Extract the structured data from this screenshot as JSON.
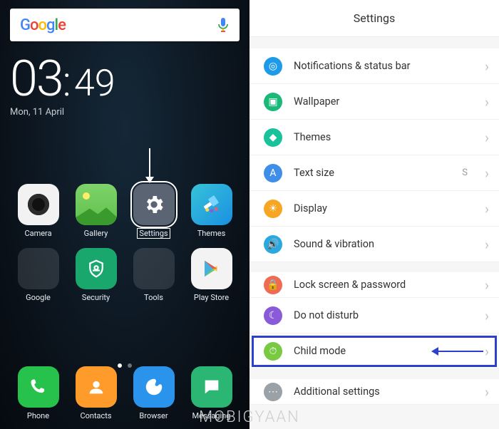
{
  "home": {
    "search": {
      "brand": "Google"
    },
    "clock": {
      "hour": "03",
      "min": "49"
    },
    "date": "Mon, 11 April",
    "apps": {
      "camera": "Camera",
      "gallery": "Gallery",
      "settings": "Settings",
      "themes": "Themes",
      "google": "Google",
      "security": "Security",
      "tools": "Tools",
      "playstore": "Play Store"
    },
    "dock": {
      "phone": "Phone",
      "contacts": "Contacts",
      "browser": "Browser",
      "messaging": "Messaging"
    }
  },
  "settings": {
    "title": "Settings",
    "rows": {
      "notifications": "Notifications & status bar",
      "wallpaper": "Wallpaper",
      "themes": "Themes",
      "textsize": "Text size",
      "textsize_value": "S",
      "display": "Display",
      "sound": "Sound & vibration",
      "lock": "Lock screen & password",
      "dnd": "Do not disturb",
      "childmode": "Child mode",
      "additional": "Additional settings"
    }
  },
  "watermark": "MOBIGYAAN"
}
